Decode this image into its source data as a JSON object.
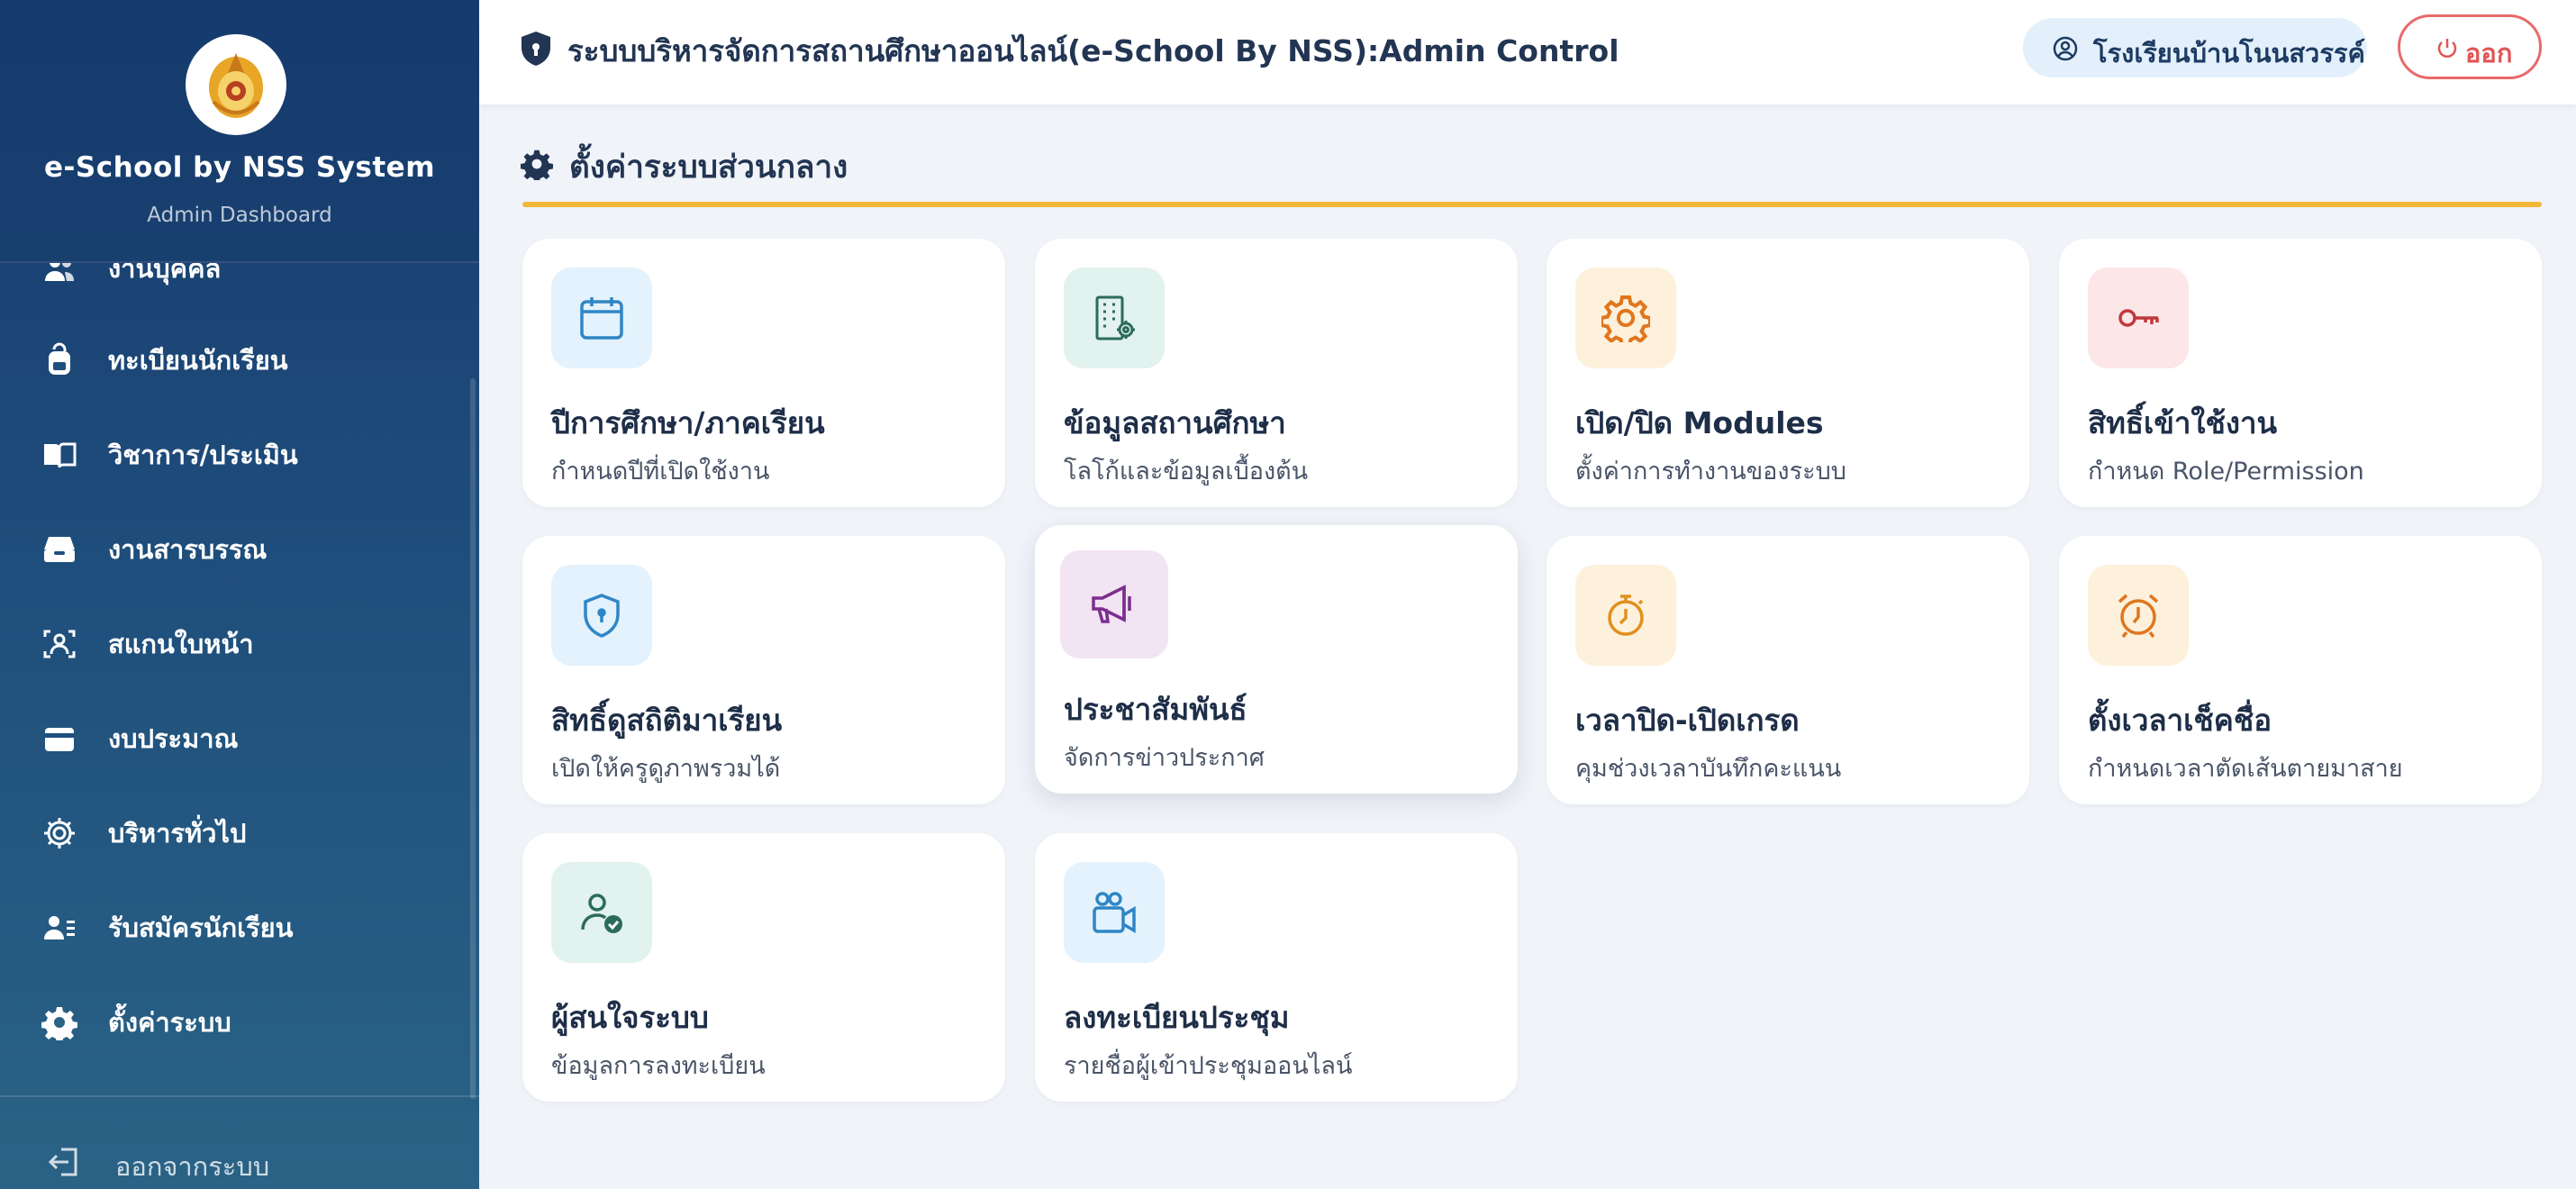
{
  "brand": {
    "title": "e-School by NSS System",
    "subtitle": "Admin Dashboard"
  },
  "sidebar": {
    "items": [
      {
        "label": "งานบุคคล",
        "icon": "users-icon"
      },
      {
        "label": "ทะเบียนนักเรียน",
        "icon": "backpack-icon"
      },
      {
        "label": "วิชาการ/ประเมิน",
        "icon": "book-open-icon"
      },
      {
        "label": "งานสารบรรณ",
        "icon": "inbox-tray-icon"
      },
      {
        "label": "สแกนใบหน้า",
        "icon": "face-scan-icon"
      },
      {
        "label": "งบประมาณ",
        "icon": "wallet-icon"
      },
      {
        "label": "บริหารทั่วไป",
        "icon": "gear-outline-icon"
      },
      {
        "label": "รับสมัครนักเรียน",
        "icon": "user-list-icon"
      },
      {
        "label": "ตั้งค่าระบบ",
        "icon": "gear-icon"
      }
    ],
    "logout_label": "ออกจากระบบ"
  },
  "header": {
    "title": "ระบบบริหารจัดการสถานศึกษาออนไลน์(e-School By NSS):Admin Control",
    "school": "โรงเรียนบ้านโนนสวรรค์",
    "logout": "ออก"
  },
  "section": {
    "title": "ตั้งค่าระบบส่วนกลาง",
    "accent": "#f3b73a"
  },
  "cards": [
    {
      "title": "ปีการศึกษา/ภาคเรียน",
      "subtitle": "กำหนดปีที่เปิดใช้งาน",
      "icon": "calendar-icon",
      "bg": "#e3f2fc",
      "color": "#2f86c6"
    },
    {
      "title": "ข้อมูลสถานศึกษา",
      "subtitle": "โลโก้และข้อมูลเบื้องต้น",
      "icon": "building-gear-icon",
      "bg": "#e2f2ee",
      "color": "#2c6b5a"
    },
    {
      "title": "เปิด/ปิด Modules",
      "subtitle": "ตั้งค่าการทำงานของระบบ",
      "icon": "cog-icon",
      "bg": "#fdf1dc",
      "color": "#e0761e"
    },
    {
      "title": "สิทธิ์เข้าใช้งาน",
      "subtitle": "กำหนด Role/Permission",
      "icon": "key-icon",
      "bg": "#fce6e8",
      "color": "#c0393b"
    },
    {
      "title": "สิทธิ์ดูสถิติมาเรียน",
      "subtitle": "เปิดให้ครูดูภาพรวมได้",
      "icon": "shield-lock-icon",
      "bg": "#e3f2fc",
      "color": "#2f86c6"
    },
    {
      "title": "ประชาสัมพันธ์",
      "subtitle": "จัดการข่าวประกาศ",
      "icon": "megaphone-icon",
      "bg": "#f2e4f3",
      "color": "#7b2f8f"
    },
    {
      "title": "เวลาปิด-เปิดเกรด",
      "subtitle": "คุมช่วงเวลาบันทึกคะแนน",
      "icon": "stopwatch-icon",
      "bg": "#fdf1dc",
      "color": "#e0901e"
    },
    {
      "title": "ตั้งเวลาเช็คชื่อ",
      "subtitle": "กำหนดเวลาตัดเส้นตายมาสาย",
      "icon": "alarm-clock-icon",
      "bg": "#fdf1dc",
      "color": "#e0761e"
    },
    {
      "title": "ผู้สนใจระบบ",
      "subtitle": "ข้อมูลการลงทะเบียน",
      "icon": "user-check-icon",
      "bg": "#e2f2ee",
      "color": "#2c6b5a"
    },
    {
      "title": "ลงทะเบียนประชุม",
      "subtitle": "รายชื่อผู้เข้าประชุมออนไลน์",
      "icon": "video-camera-icon",
      "bg": "#e3f2fc",
      "color": "#2f86c6"
    }
  ]
}
